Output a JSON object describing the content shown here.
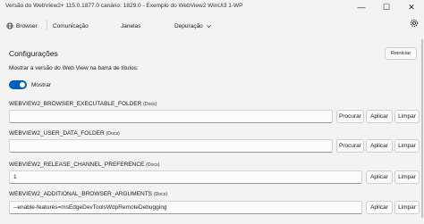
{
  "window": {
    "title": "Versão do WebView2+ 115.0.1877.0 canário: 1829.0 - Exemplo do WebView2 WinUI3 1-WP",
    "minimize_glyph": "—",
    "maximize_glyph": "☐",
    "close_glyph": "✕"
  },
  "nav": {
    "items": [
      {
        "label": "Browser",
        "icon": "globe-icon"
      },
      {
        "label": "Comunicação"
      },
      {
        "label": "Janelas"
      },
      {
        "label": "Depuração",
        "icon": "chevron-down-icon"
      }
    ],
    "settings_icon": "gear-icon"
  },
  "settings": {
    "title": "Configurações",
    "reset_label": "Reiniciar",
    "show_version_label": "Mostrar a versão do Web View na barra de títulos:",
    "toggle_label": "Mostrar",
    "toggle_on": true,
    "accent_color": "#005fb8",
    "docs_label": "(Docs)",
    "fields": [
      {
        "name": "WEBVIEW2_BROWSER_EXECUTABLE_FOLDER",
        "value": "",
        "browse_label": "Procurar",
        "apply_label": "Aplicar",
        "clear_label": "Limpar"
      },
      {
        "name": "WEBVIEW2_USER_DATA_FOLDER",
        "value": "",
        "browse_label": "Procurar",
        "apply_label": "Aplicar",
        "clear_label": "Limpar"
      },
      {
        "name": "WEBVIEW2_RELEASE_CHANNEL_PREFERENCE",
        "value": "1",
        "apply_label": "Aplicar",
        "clear_label": "Limpar"
      },
      {
        "name": "WEBVIEW2_ADDITIONAL_BROWSER_ARGUMENTS",
        "value": "--enable-features=msEdgeDevToolsWdpRemoteDebugging",
        "apply_label": "Aplicar",
        "clear_label": "Limpar"
      }
    ]
  }
}
